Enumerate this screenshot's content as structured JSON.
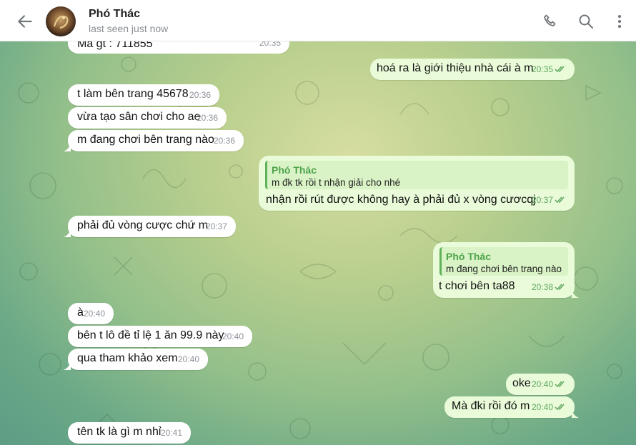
{
  "header": {
    "name": "Phó Thác",
    "status": "last seen just now",
    "icons": [
      "back-arrow-icon",
      "avatar",
      "phone-icon",
      "search-icon",
      "more-vert-icon"
    ]
  },
  "colors": {
    "incoming_bubble": "#ffffff",
    "outgoing_bubble": "#e9fbd8",
    "check_color": "#5ea65f",
    "reply_accent": "#4ea34b"
  },
  "messages": [
    {
      "id": "m1",
      "dir": "in",
      "text": "Mã gt : 711855",
      "time": "20:35"
    },
    {
      "id": "m2",
      "dir": "out",
      "text": "hoá ra là giới thiệu nhà cái à m",
      "time": "20:35",
      "read": true
    },
    {
      "id": "m3",
      "dir": "in",
      "text": "t làm bên trang 45678",
      "time": "20:36"
    },
    {
      "id": "m4",
      "dir": "in",
      "text": "vừa tạo sân chơi cho ae",
      "time": "20:36"
    },
    {
      "id": "m5",
      "dir": "in",
      "text": "m đang chơi bên trang nào",
      "time": "20:36"
    },
    {
      "id": "m6",
      "dir": "out",
      "reply_name": "Phó Thác",
      "reply_text": "m đk tk rồi t nhận giải cho nhé",
      "text": "nhận rồi rút được không hay à phải đủ x vòng cươcqj",
      "time": "20:37",
      "read": true
    },
    {
      "id": "m7",
      "dir": "in",
      "text": "phải đủ vòng cược chứ m",
      "time": "20:37"
    },
    {
      "id": "m8",
      "dir": "out",
      "reply_name": "Phó Thác",
      "reply_text": "m đang chơi bên trang nào",
      "text": "t chơi bên ta88",
      "time": "20:38",
      "read": true
    },
    {
      "id": "m9",
      "dir": "in",
      "text": "à",
      "time": "20:40"
    },
    {
      "id": "m10",
      "dir": "in",
      "text": "bên t lô đề tỉ lệ 1 ăn 99.9 này",
      "time": "20:40"
    },
    {
      "id": "m11",
      "dir": "in",
      "text": "qua tham khảo xem",
      "time": "20:40"
    },
    {
      "id": "m12",
      "dir": "out",
      "text": "oke",
      "time": "20:40",
      "read": true
    },
    {
      "id": "m13",
      "dir": "out",
      "text": "Mà đki rồi đó m",
      "time": "20:40",
      "read": true
    },
    {
      "id": "m14",
      "dir": "in",
      "text": "tên tk là gì m nhỉ",
      "time": "20:41"
    }
  ]
}
